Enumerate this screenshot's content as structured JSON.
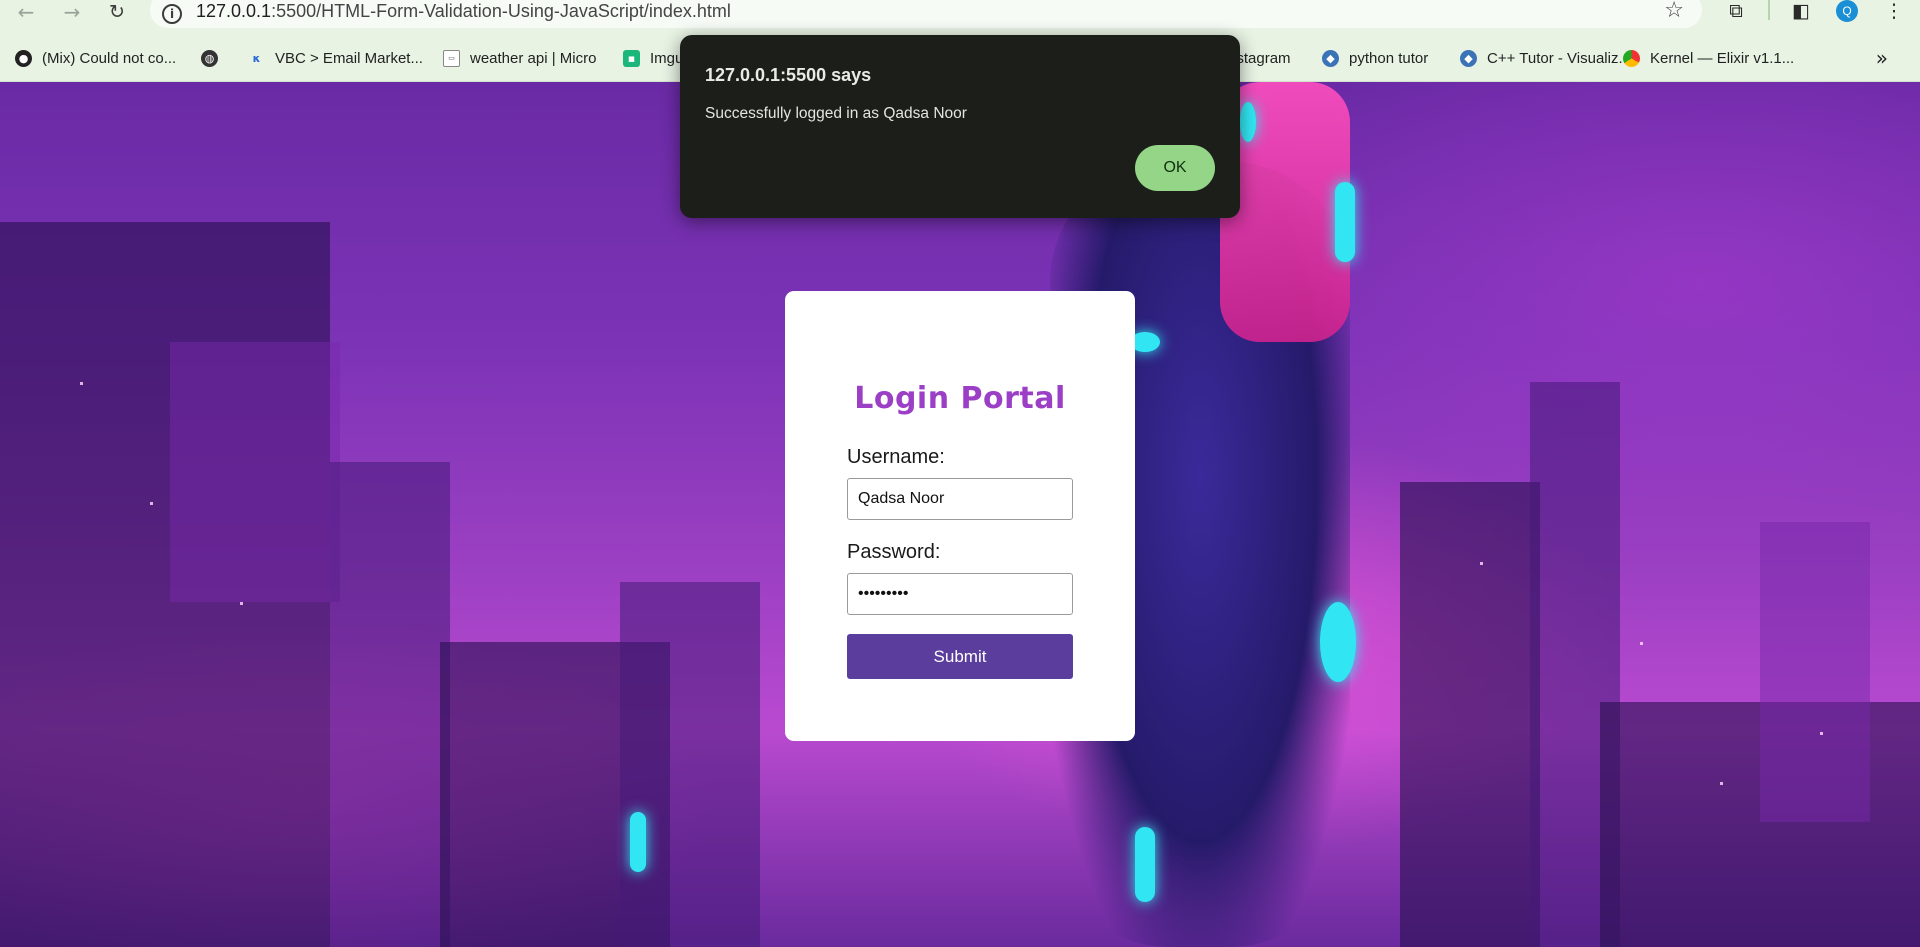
{
  "browser": {
    "url_host": "127.0.0.1",
    "url_rest": ":5500/HTML-Form-Validation-Using-JavaScript/index.html",
    "profile_initial": "Q",
    "bookmarks": [
      {
        "label": "(Mix) Could not co...",
        "icon": "github-icon"
      },
      {
        "label": "",
        "icon": "globe-icon"
      },
      {
        "label": "VBC > Email Market...",
        "icon": "vbc-icon"
      },
      {
        "label": "weather api | Micro",
        "icon": "weather-api-icon"
      },
      {
        "label": "Imgu",
        "icon": "imgur-icon"
      },
      {
        "label": "nstagram",
        "icon": "instagram-icon"
      },
      {
        "label": "python tutor",
        "icon": "python-icon"
      },
      {
        "label": "C++ Tutor - Visualiz...",
        "icon": "python-icon"
      },
      {
        "label": "Kernel — Elixir v1.1...",
        "icon": "chrome-icon"
      }
    ]
  },
  "login": {
    "title": "Login Portal",
    "username_label": "Username:",
    "username_value": "Qadsa Noor",
    "password_label": "Password:",
    "password_value": "•••••••••",
    "submit_label": "Submit"
  },
  "dialog": {
    "title": "127.0.0.1:5500 says",
    "message": "Successfully logged in as Qadsa Noor",
    "ok_label": "OK"
  },
  "colors": {
    "title_purple": "#9b3fc6",
    "button_purple": "#5b3d9e",
    "ok_green": "#94d587",
    "dialog_bg": "#1b1e19"
  }
}
